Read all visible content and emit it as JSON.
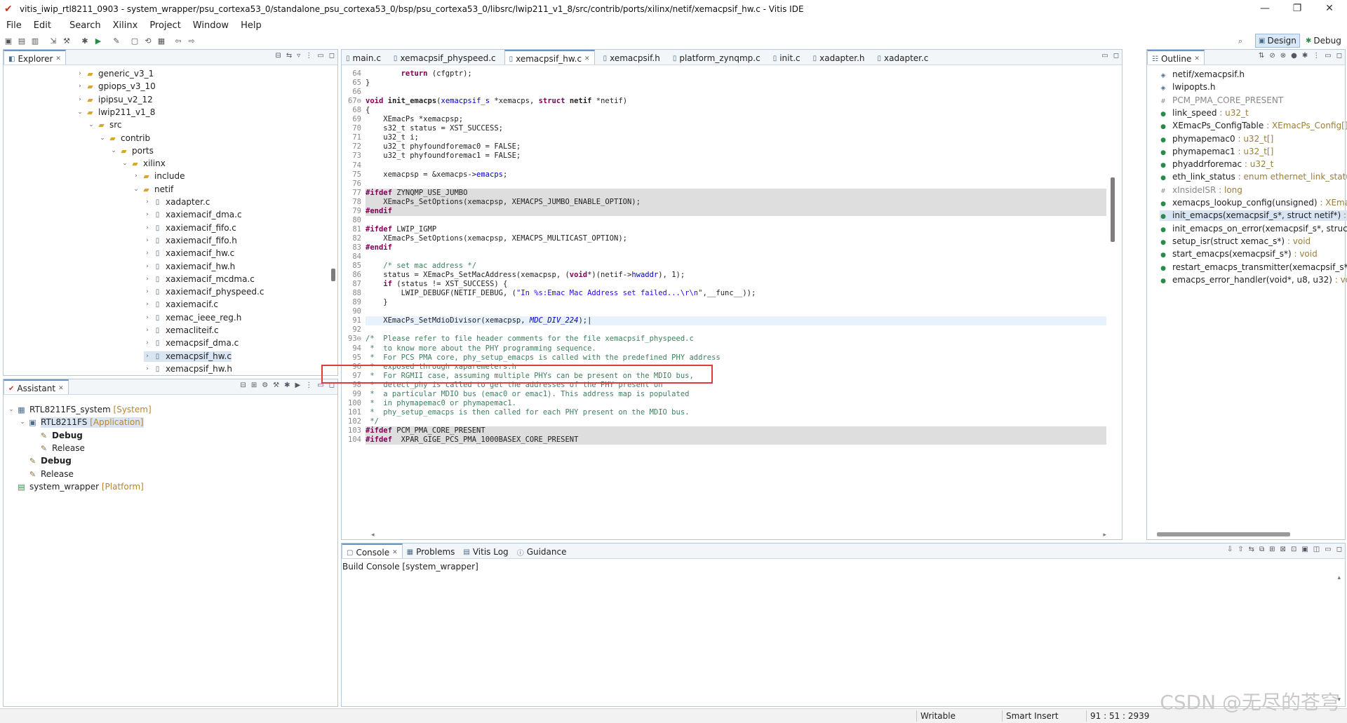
{
  "window": {
    "title": "vitis_iwip_rtl8211_0903 - system_wrapper/psu_cortexa53_0/standalone_psu_cortexa53_0/bsp/psu_cortexa53_0/libsrc/lwip211_v1_8/src/contrib/ports/xilinx/netif/xemacpsif_hw.c - Vitis IDE",
    "controls": [
      "—",
      "❐",
      "✕"
    ]
  },
  "menu": [
    "File",
    "Edit",
    "Search",
    "Xilinx",
    "Project",
    "Window",
    "Help"
  ],
  "perspectives": {
    "design": "Design",
    "debug": "Debug"
  },
  "explorer": {
    "tab": "Explorer",
    "items": [
      {
        "label": "generic_v3_1",
        "depth": 0,
        "twisty": "›",
        "kind": "folder"
      },
      {
        "label": "gpiops_v3_10",
        "depth": 0,
        "twisty": "›",
        "kind": "folder"
      },
      {
        "label": "ipipsu_v2_12",
        "depth": 0,
        "twisty": "›",
        "kind": "folder"
      },
      {
        "label": "lwip211_v1_8",
        "depth": 0,
        "twisty": "⌄",
        "kind": "folder"
      },
      {
        "label": "src",
        "depth": 1,
        "twisty": "⌄",
        "kind": "folder"
      },
      {
        "label": "contrib",
        "depth": 2,
        "twisty": "⌄",
        "kind": "folder"
      },
      {
        "label": "ports",
        "depth": 3,
        "twisty": "⌄",
        "kind": "folder"
      },
      {
        "label": "xilinx",
        "depth": 4,
        "twisty": "⌄",
        "kind": "folder"
      },
      {
        "label": "include",
        "depth": 5,
        "twisty": "›",
        "kind": "folder"
      },
      {
        "label": "netif",
        "depth": 5,
        "twisty": "⌄",
        "kind": "folder"
      },
      {
        "label": "xadapter.c",
        "depth": 6,
        "twisty": "›",
        "kind": "file"
      },
      {
        "label": "xaxiemacif_dma.c",
        "depth": 6,
        "twisty": "›",
        "kind": "file"
      },
      {
        "label": "xaxiemacif_fifo.c",
        "depth": 6,
        "twisty": "›",
        "kind": "file"
      },
      {
        "label": "xaxiemacif_fifo.h",
        "depth": 6,
        "twisty": "›",
        "kind": "file"
      },
      {
        "label": "xaxiemacif_hw.c",
        "depth": 6,
        "twisty": "›",
        "kind": "file"
      },
      {
        "label": "xaxiemacif_hw.h",
        "depth": 6,
        "twisty": "›",
        "kind": "file"
      },
      {
        "label": "xaxiemacif_mcdma.c",
        "depth": 6,
        "twisty": "›",
        "kind": "file"
      },
      {
        "label": "xaxiemacif_physpeed.c",
        "depth": 6,
        "twisty": "›",
        "kind": "file"
      },
      {
        "label": "xaxiemacif.c",
        "depth": 6,
        "twisty": "›",
        "kind": "file"
      },
      {
        "label": "xemac_ieee_reg.h",
        "depth": 6,
        "twisty": "›",
        "kind": "file"
      },
      {
        "label": "xemacliteif.c",
        "depth": 6,
        "twisty": "›",
        "kind": "file"
      },
      {
        "label": "xemacpsif_dma.c",
        "depth": 6,
        "twisty": "›",
        "kind": "file"
      },
      {
        "label": "xemacpsif_hw.c",
        "depth": 6,
        "twisty": "›",
        "kind": "file",
        "selected": true
      },
      {
        "label": "xemacpsif_hw.h",
        "depth": 6,
        "twisty": "›",
        "kind": "file"
      }
    ]
  },
  "assistant": {
    "tab": "Assistant",
    "items": [
      {
        "label": "RTL8211FS_system",
        "tag": "[System]",
        "depth": 0,
        "twisty": "⌄",
        "icon": "▦",
        "bold": false
      },
      {
        "label": "RTL8211FS",
        "tag": "[Application]",
        "depth": 1,
        "twisty": "⌄",
        "icon": "▣",
        "bold": false,
        "selected": true
      },
      {
        "label": "Debug",
        "tag": "",
        "depth": 2,
        "twisty": "",
        "icon": "✎",
        "bold": true
      },
      {
        "label": "Release",
        "tag": "",
        "depth": 2,
        "twisty": "",
        "icon": "✎",
        "bold": false
      },
      {
        "label": "Debug",
        "tag": "",
        "depth": 1,
        "twisty": "",
        "icon": "✎",
        "bold": true
      },
      {
        "label": "Release",
        "tag": "",
        "depth": 1,
        "twisty": "",
        "icon": "✎",
        "bold": false
      },
      {
        "label": "system_wrapper",
        "tag": "[Platform]",
        "depth": 0,
        "twisty": "",
        "icon": "▤",
        "bold": false
      }
    ]
  },
  "editor": {
    "tabs": [
      {
        "label": "main.c",
        "active": false
      },
      {
        "label": "xemacpsif_physpeed.c",
        "active": false
      },
      {
        "label": "xemacpsif_hw.c",
        "active": true
      },
      {
        "label": "xemacpsif.h",
        "active": false
      },
      {
        "label": "platform_zynqmp.c",
        "active": false
      },
      {
        "label": "init.c",
        "active": false
      },
      {
        "label": "xadapter.h",
        "active": false
      },
      {
        "label": "xadapter.c",
        "active": false
      }
    ],
    "lines": [
      {
        "n": "64",
        "bg": "",
        "segs": [
          [
            "        ",
            ""
          ],
          [
            "return",
            "kw"
          ],
          [
            " (cfgptr);",
            ""
          ]
        ]
      },
      {
        "n": "65",
        "bg": "",
        "segs": [
          [
            "}",
            ""
          ]
        ]
      },
      {
        "n": "66",
        "bg": "",
        "segs": [
          [
            "",
            ""
          ]
        ]
      },
      {
        "n": "67⊖",
        "bg": "",
        "segs": [
          [
            "void",
            "kw"
          ],
          [
            " ",
            ""
          ],
          [
            "init_emacps",
            "b"
          ],
          [
            "(",
            ""
          ],
          [
            "xemacpsif_s",
            "fn"
          ],
          [
            " *xemacps, ",
            ""
          ],
          [
            "struct",
            "kw"
          ],
          [
            " ",
            ""
          ],
          [
            "netif",
            "b"
          ],
          [
            " *netif)",
            ""
          ]
        ]
      },
      {
        "n": "68",
        "bg": "",
        "segs": [
          [
            "{",
            ""
          ]
        ]
      },
      {
        "n": "69",
        "bg": "",
        "segs": [
          [
            "    XEmacPs *xemacpsp;",
            ""
          ]
        ]
      },
      {
        "n": "70",
        "bg": "",
        "segs": [
          [
            "    s32_t status = XST_SUCCESS;",
            ""
          ]
        ]
      },
      {
        "n": "71",
        "bg": "",
        "segs": [
          [
            "    u32_t i;",
            ""
          ]
        ]
      },
      {
        "n": "72",
        "bg": "",
        "segs": [
          [
            "    u32_t phyfoundforemac0 = FALSE;",
            ""
          ]
        ]
      },
      {
        "n": "73",
        "bg": "",
        "segs": [
          [
            "    u32_t phyfoundforemac1 = FALSE;",
            ""
          ]
        ]
      },
      {
        "n": "74",
        "bg": "",
        "segs": [
          [
            "",
            ""
          ]
        ]
      },
      {
        "n": "75",
        "bg": "",
        "segs": [
          [
            "    xemacpsp = &xemacps->",
            ""
          ],
          [
            "emacps",
            "fld"
          ],
          [
            ";",
            ""
          ]
        ]
      },
      {
        "n": "76",
        "bg": "",
        "segs": [
          [
            "",
            ""
          ]
        ]
      },
      {
        "n": "77",
        "bg": "gray",
        "segs": [
          [
            "#ifdef",
            "kw"
          ],
          [
            " ZYNQMP_USE_JUMBO",
            ""
          ]
        ]
      },
      {
        "n": "78",
        "bg": "gray",
        "segs": [
          [
            "    XEmacPs_SetOptions(xemacpsp, XEMACPS_JUMBO_ENABLE_OPTION);",
            ""
          ]
        ]
      },
      {
        "n": "79",
        "bg": "gray",
        "segs": [
          [
            "#endif",
            "kw"
          ]
        ]
      },
      {
        "n": "80",
        "bg": "",
        "segs": [
          [
            "",
            ""
          ]
        ]
      },
      {
        "n": "81",
        "bg": "",
        "segs": [
          [
            "#ifdef",
            "kw"
          ],
          [
            " LWIP_IGMP",
            ""
          ]
        ]
      },
      {
        "n": "82",
        "bg": "",
        "segs": [
          [
            "    XEmacPs_SetOptions(xemacpsp, XEMACPS_MULTICAST_OPTION);",
            ""
          ]
        ]
      },
      {
        "n": "83",
        "bg": "",
        "segs": [
          [
            "#endif",
            "kw"
          ]
        ]
      },
      {
        "n": "84",
        "bg": "",
        "segs": [
          [
            "",
            ""
          ]
        ]
      },
      {
        "n": "85",
        "bg": "",
        "segs": [
          [
            "    /* set mac address */",
            "cm"
          ]
        ]
      },
      {
        "n": "86",
        "bg": "",
        "segs": [
          [
            "    status = XEmacPs_SetMacAddress(xemacpsp, (",
            ""
          ],
          [
            "void",
            "kw"
          ],
          [
            "*)(netif->",
            ""
          ],
          [
            "hwaddr",
            "fld"
          ],
          [
            "), 1);",
            ""
          ]
        ]
      },
      {
        "n": "87",
        "bg": "",
        "segs": [
          [
            "    ",
            ""
          ],
          [
            "if",
            "kw"
          ],
          [
            " (status != XST_SUCCESS) {",
            ""
          ]
        ]
      },
      {
        "n": "88",
        "bg": "",
        "segs": [
          [
            "        LWIP_DEBUGF(NETIF_DEBUG, (",
            ""
          ],
          [
            "\"In %s:Emac Mac Address set failed...\\r\\n\"",
            "str"
          ],
          [
            ",__func__));",
            ""
          ]
        ]
      },
      {
        "n": "89",
        "bg": "",
        "segs": [
          [
            "    }",
            ""
          ]
        ]
      },
      {
        "n": "90",
        "bg": "",
        "segs": [
          [
            "",
            ""
          ]
        ]
      },
      {
        "n": "91",
        "bg": "cur",
        "segs": [
          [
            "    XEmacPs_SetMdioDivisor(xemacpsp, ",
            ""
          ],
          [
            "MDC_DIV_224",
            "mi"
          ],
          [
            ");",
            ""
          ]
        ]
      },
      {
        "n": "92",
        "bg": "",
        "segs": [
          [
            "",
            ""
          ]
        ]
      },
      {
        "n": "93⊖",
        "bg": "",
        "segs": [
          [
            "/*  Please refer to file header comments for the file xemacpsif_physpeed.c",
            "cm"
          ]
        ]
      },
      {
        "n": "94",
        "bg": "",
        "segs": [
          [
            " *  to know more about the PHY programming sequence.",
            "cm"
          ]
        ]
      },
      {
        "n": "95",
        "bg": "",
        "segs": [
          [
            " *  For PCS PMA core, phy_setup_emacps is called with the predefined PHY address",
            "cm"
          ]
        ]
      },
      {
        "n": "96",
        "bg": "",
        "segs": [
          [
            " *  exposed through xaparemeters.h",
            "cm"
          ]
        ]
      },
      {
        "n": "97",
        "bg": "",
        "segs": [
          [
            " *  For RGMII case, assuming multiple PHYs can be present on the MDIO bus,",
            "cm"
          ]
        ]
      },
      {
        "n": "98",
        "bg": "",
        "segs": [
          [
            " *  detect_phy is called to get the addresses of the PHY present on",
            "cm"
          ]
        ]
      },
      {
        "n": "99",
        "bg": "",
        "segs": [
          [
            " *  a particular MDIO bus (emac0 or emac1). This address map is populated",
            "cm"
          ]
        ]
      },
      {
        "n": "100",
        "bg": "",
        "segs": [
          [
            " *  in phymapemac0 or phymapemac1.",
            "cm"
          ]
        ]
      },
      {
        "n": "101",
        "bg": "",
        "segs": [
          [
            " *  phy_setup_emacps is then called for each PHY present on the MDIO bus.",
            "cm"
          ]
        ]
      },
      {
        "n": "102",
        "bg": "",
        "segs": [
          [
            " */",
            "cm"
          ]
        ]
      },
      {
        "n": "103",
        "bg": "gray",
        "segs": [
          [
            "#ifdef",
            "kw"
          ],
          [
            " PCM_PMA_CORE_PRESENT",
            ""
          ]
        ]
      },
      {
        "n": "104",
        "bg": "gray",
        "segs": [
          [
            "#ifdef",
            "kw"
          ],
          [
            "  XPAR_GIGE_PCS_PMA_1000BASEX_CORE_PRESENT",
            ""
          ]
        ]
      }
    ]
  },
  "outline": {
    "tab": "Outline",
    "items": [
      {
        "name": "netif/xemacpsif.h",
        "type": "",
        "icon": "◈",
        "color": "#4a6b8a",
        "gray": false
      },
      {
        "name": "lwipopts.h",
        "type": "",
        "icon": "◈",
        "color": "#4a6b8a",
        "gray": false
      },
      {
        "name": "PCM_PMA_CORE_PRESENT",
        "type": "",
        "icon": "#",
        "color": "#888",
        "gray": true
      },
      {
        "name": "link_speed",
        "type": " : u32_t",
        "icon": "●",
        "color": "#2a8a4a",
        "gray": false
      },
      {
        "name": "XEmacPs_ConfigTable",
        "type": " : XEmacPs_Config[]",
        "icon": "●",
        "color": "#2a8a4a",
        "gray": false
      },
      {
        "name": "phymapemac0",
        "type": " : u32_t[]",
        "icon": "●",
        "color": "#2a8a4a",
        "gray": false
      },
      {
        "name": "phymapemac1",
        "type": " : u32_t[]",
        "icon": "●",
        "color": "#2a8a4a",
        "gray": false
      },
      {
        "name": "phyaddrforemac",
        "type": " : u32_t",
        "icon": "●",
        "color": "#2a8a4a",
        "gray": false
      },
      {
        "name": "eth_link_status",
        "type": " : enum ethernet_link_status",
        "icon": "●",
        "color": "#2a8a4a",
        "gray": false
      },
      {
        "name": "xInsideISR",
        "type": " : long",
        "icon": "#",
        "color": "#888",
        "gray": true
      },
      {
        "name": "xemacps_lookup_config(unsigned)",
        "type": " : XEmacPs",
        "icon": "●",
        "color": "#2a8a4a",
        "gray": false
      },
      {
        "name": "init_emacps(xemacpsif_s*, struct netif*)",
        "type": " : void",
        "icon": "●",
        "color": "#2a8a4a",
        "gray": false,
        "selected": true
      },
      {
        "name": "init_emacps_on_error(xemacpsif_s*, struct netif*)",
        "type": "",
        "icon": "●",
        "color": "#2a8a4a",
        "gray": false
      },
      {
        "name": "setup_isr(struct xemac_s*)",
        "type": " : void",
        "icon": "●",
        "color": "#2a8a4a",
        "gray": false
      },
      {
        "name": "start_emacps(xemacpsif_s*)",
        "type": " : void",
        "icon": "●",
        "color": "#2a8a4a",
        "gray": false
      },
      {
        "name": "restart_emacps_transmitter(xemacpsif_s*)",
        "type": "",
        "icon": "●",
        "color": "#2a8a4a",
        "gray": false
      },
      {
        "name": "emacps_error_handler(void*, u8, u32)",
        "type": " : void",
        "icon": "●",
        "color": "#2a8a4a",
        "gray": false
      }
    ]
  },
  "console": {
    "tabs": [
      "Console",
      "Problems",
      "Vitis Log",
      "Guidance"
    ],
    "header": "Build Console [system_wrapper]"
  },
  "status": {
    "writable": "Writable",
    "insert": "Smart Insert",
    "position": "91 : 51 : 2939"
  },
  "watermark": "CSDN @无尽的苍穹"
}
